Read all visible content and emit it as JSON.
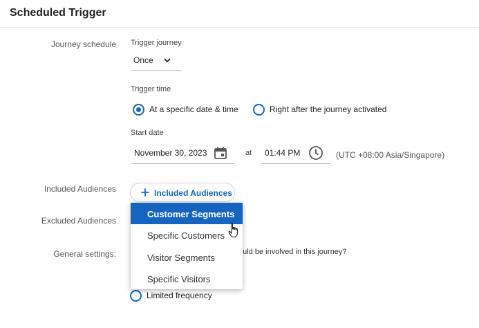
{
  "header": {
    "title": "Scheduled Trigger"
  },
  "labels": {
    "journey_schedule": "Journey schedule",
    "included_audiences": "Included Audiences",
    "excluded_audiences": "Excluded Audiences",
    "general_settings": "General settings:"
  },
  "trigger_journey": {
    "label": "Trigger journey",
    "value": "Once",
    "icon": "chevron-down-icon"
  },
  "trigger_time": {
    "label": "Trigger time",
    "options": [
      {
        "label": "At a specific date & time",
        "selected": true
      },
      {
        "label": "Right after the journey activated",
        "selected": false
      }
    ]
  },
  "start_date": {
    "label": "Start date",
    "date_value": "November 30, 2023",
    "at_label": "at",
    "time_value": "01:44 PM",
    "timezone": "(UTC +08:00 Asia/Singapore)",
    "date_icon": "calendar-icon",
    "time_icon": "clock-icon"
  },
  "included_button": {
    "label": "Included Audiences",
    "icon": "plus-icon"
  },
  "dropdown": {
    "items": [
      {
        "label": "Customer Segments",
        "active": true
      },
      {
        "label": "Specific Customers",
        "active": false
      },
      {
        "label": "Visitor Segments",
        "active": false
      },
      {
        "label": "Specific Visitors",
        "active": false
      }
    ]
  },
  "general": {
    "question_partial": "ould be involved in this journey?",
    "limited_frequency": "Limited frequency"
  },
  "colors": {
    "accent": "#1565c0",
    "menu_active_bg": "#1565c0"
  }
}
